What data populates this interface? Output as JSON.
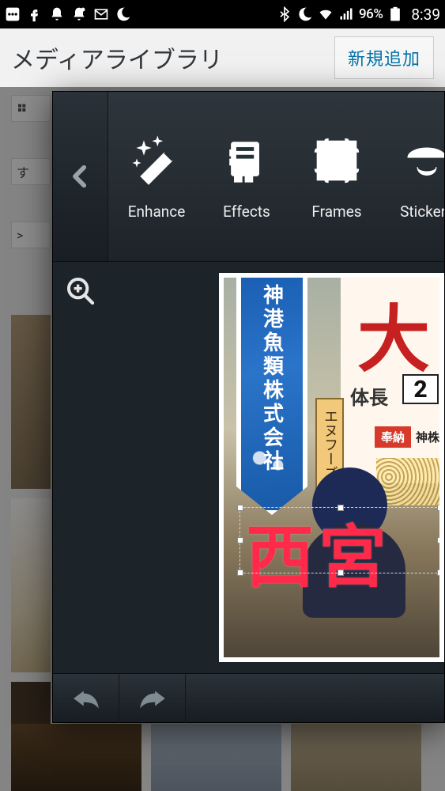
{
  "status": {
    "battery": "96%",
    "clock": "8:39"
  },
  "page": {
    "title": "メディアライブラリ",
    "add_new": "新規追加"
  },
  "editor": {
    "tools": {
      "enhance": "Enhance",
      "effects": "Effects",
      "frames": "Frames",
      "stickers": "Stickers"
    }
  },
  "photo": {
    "banner_text": "神港魚類株式会社",
    "big_kanji": "大",
    "length_label": "体長",
    "length_value": "2",
    "ribbon_label": "奉納",
    "ribbon_text": "神株",
    "sign_text": "エヌフーズ㈱",
    "overlay_text": "西宮"
  }
}
